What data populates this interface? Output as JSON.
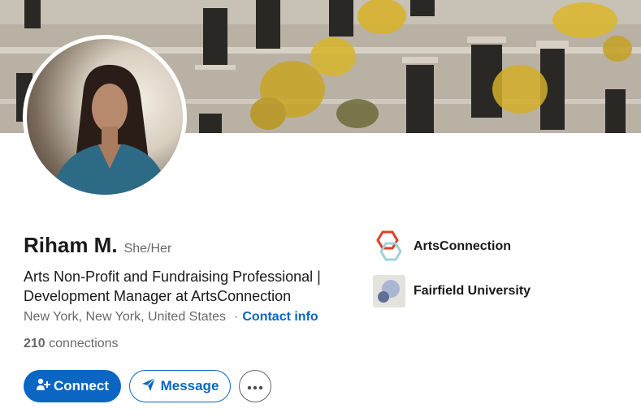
{
  "profile": {
    "name": "Riham M.",
    "pronouns": "She/Her",
    "headline": "Arts Non-Profit and Fundraising Professional | Development Manager at ArtsConnection",
    "location": "New York, New York, United States",
    "separator": "·",
    "contact_info": "Contact info",
    "connections_count": "210",
    "connections_label": "connections"
  },
  "actions": {
    "connect_label": "Connect",
    "message_label": "Message"
  },
  "organizations": [
    {
      "name": "ArtsConnection",
      "icon": "artsconnection-logo"
    },
    {
      "name": "Fairfield University",
      "icon": "fairfield-university-logo"
    }
  ],
  "colors": {
    "primary": "#0a66c2",
    "text_secondary": "#666666"
  }
}
